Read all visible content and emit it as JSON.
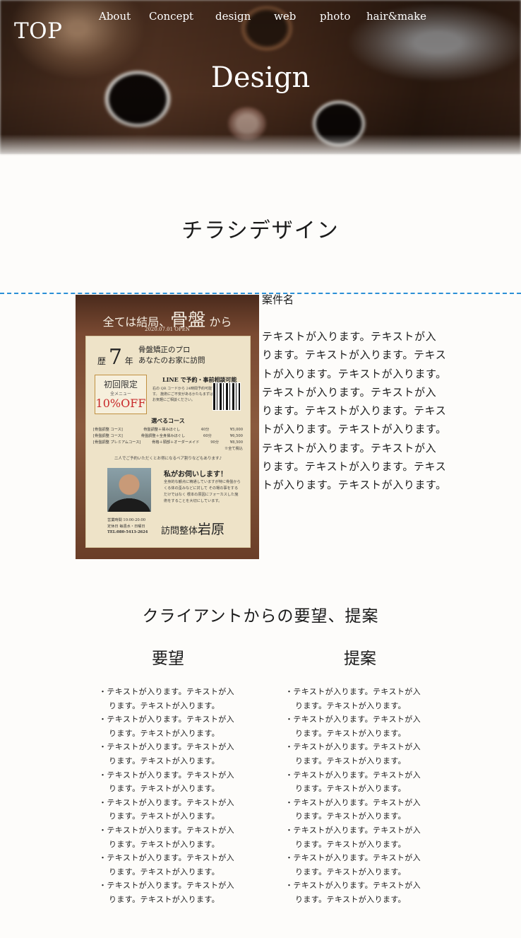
{
  "header": {
    "logo": "TOP",
    "nav": [
      "About",
      "Concept",
      "design",
      "web",
      "photo",
      "hair&make"
    ],
    "hero_title": "Design"
  },
  "section": {
    "title": "チラシデザイン",
    "case_name": "案件名",
    "case_text": "テキストが入ります。テキストが入ります。テキストが入ります。テキストが入ります。テキストが入ります。テキストが入ります。テキストが入ります。テキストが入ります。テキストが入ります。テキストが入ります。テキストが入ります。テキストが入ります。テキストが入ります。テキストが入ります。テキストが入ります。"
  },
  "flyer": {
    "headline_pre": "全ては結局、",
    "headline_main": "骨盤",
    "headline_post": "から",
    "date": "2020.07.01 OPEN",
    "years_pre": "歴",
    "years_num": "7",
    "years_post": "年",
    "pro_line1": "骨盤矯正のプロ",
    "pro_line2": "あなたのお家に訪問",
    "limit_title": "初回限定",
    "limit_sub": "全メニュー",
    "limit_off": "10%OFF",
    "line_title": "LINE で予約・事前相談可能",
    "line_desc": "右の QR コードから 24時間予約可能です。 施術にご不安があるかたもまずはお気軽にご相談ください。",
    "course_title": "選べるコース",
    "courses": [
      {
        "name": "[骨盤調整 コース]",
        "detail": "骨盤調整＋揉みほぐし",
        "time": "40分",
        "price": "¥5,000"
      },
      {
        "name": "[骨盤調整 コース]",
        "detail": "骨盤調整＋全身揉みほぐし",
        "time": "60分",
        "price": "¥6,500"
      },
      {
        "name": "[骨盤調整 プレミアムコース]",
        "detail": "骨格＋頭部＋オーダーメイド",
        "time": "90分",
        "price": "¥8,500"
      }
    ],
    "tax_note": "※全て税込",
    "note": "二人でご予約いただくとお得になるペア割りなどもあります♪",
    "ask_title": "私がお伺いします！",
    "ask_desc": "全身的な観点に精通していますが特に骨盤からくる体の歪みなどに対して その場の事をするだけではなく 根本の原因にフォーカスした施術をすることを大切にしています。",
    "hours": "営業時間 10:00-20:00",
    "holiday": "定休日 毎週水・日曜日",
    "tel": "TEL:080-5413-2624",
    "brand_pre": "訪問整体",
    "brand_main": "岩原"
  },
  "requests": {
    "title": "クライアントからの要望、提案",
    "request_heading": "要望",
    "proposal_heading": "提案",
    "request_items": [
      "テキストが入ります。テキストが入ります。テキストが入ります。",
      "テキストが入ります。テキストが入ります。テキストが入ります。",
      "テキストが入ります。テキストが入ります。テキストが入ります。",
      "テキストが入ります。テキストが入ります。テキストが入ります。",
      "テキストが入ります。テキストが入ります。テキストが入ります。",
      "テキストが入ります。テキストが入ります。テキストが入ります。",
      "テキストが入ります。テキストが入ります。テキストが入ります。",
      "テキストが入ります。テキストが入ります。テキストが入ります。"
    ],
    "proposal_items": [
      "テキストが入ります。テキストが入ります。テキストが入ります。",
      "テキストが入ります。テキストが入ります。テキストが入ります。",
      "テキストが入ります。テキストが入ります。テキストが入ります。",
      "テキストが入ります。テキストが入ります。テキストが入ります。",
      "テキストが入ります。テキストが入ります。テキストが入ります。",
      "テキストが入ります。テキストが入ります。テキストが入ります。",
      "テキストが入ります。テキストが入ります。テキストが入ります。",
      "テキストが入ります。テキストが入ります。テキストが入ります。"
    ]
  },
  "colors": {
    "background": "#fdfcfa",
    "text": "#1a1a1a",
    "guide_line": "#2b8fd6",
    "hero_text": "#ffffff"
  }
}
